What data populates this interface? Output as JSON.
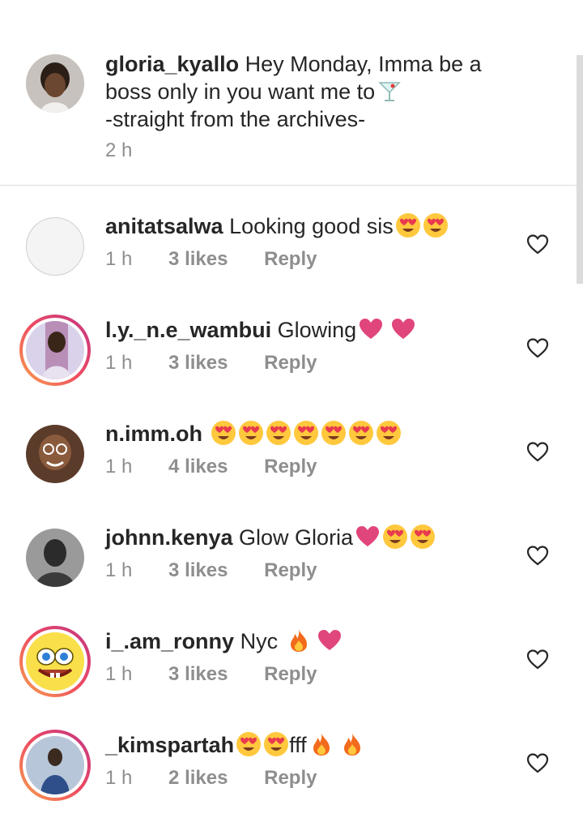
{
  "caption": {
    "username": "gloria_kyallo",
    "text_line1": " Hey Monday, Imma be a",
    "text_line2": "boss only in you want me to",
    "text_line3": "-straight from the archives-",
    "time": "2 h"
  },
  "comments": [
    {
      "username": "anitatsalwa",
      "text": " Looking good sis",
      "time": "1 h",
      "likes": "3 likes",
      "reply": "Reply"
    },
    {
      "username": "l.y._n.e_wambui",
      "text": " Glowing",
      "time": "1 h",
      "likes": "3 likes",
      "reply": "Reply"
    },
    {
      "username": "n.imm.oh",
      "text": "",
      "time": "1 h",
      "likes": "4 likes",
      "reply": "Reply"
    },
    {
      "username": "johnn.kenya",
      "text": " Glow Gloria",
      "time": "1 h",
      "likes": "3 likes",
      "reply": "Reply"
    },
    {
      "username": "i_.am_ronny",
      "text": " Nyc ",
      "time": "1 h",
      "likes": "3 likes",
      "reply": "Reply"
    },
    {
      "username": "_kimspartah",
      "text": "fff",
      "time": "1 h",
      "likes": "2 likes",
      "reply": "Reply"
    }
  ],
  "icons": {
    "heart_outline": "like-heart-outline-icon",
    "heart_eyes": "heart-eyes-emoji",
    "pink_heart": "pink-heart-emoji",
    "fire": "fire-emoji",
    "cocktail": "cocktail-emoji"
  },
  "colors": {
    "text": "#262626",
    "secondary": "#8e8e8e",
    "divider": "#dbdbdb",
    "heart_pink": "#e0457b",
    "story_ring": "#ee4a62"
  }
}
